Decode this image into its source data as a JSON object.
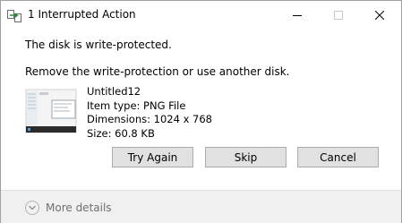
{
  "window": {
    "title": "1 Interrupted Action"
  },
  "dialog": {
    "heading": "The disk is write-protected.",
    "instruction": "Remove the write-protection or use another disk."
  },
  "file": {
    "name": "Untitled12",
    "type": "Item type: PNG File",
    "dimensions": "Dimensions: 1024 x 768",
    "size": "Size: 60.8 KB"
  },
  "buttons": {
    "try_again": "Try Again",
    "skip": "Skip",
    "cancel": "Cancel"
  },
  "footer": {
    "more_details": "More details"
  },
  "icons": {
    "app": "file-transfer-icon",
    "minimize": "minimize-icon",
    "maximize": "maximize-icon",
    "close": "close-icon",
    "expand": "chevron-down-icon"
  }
}
